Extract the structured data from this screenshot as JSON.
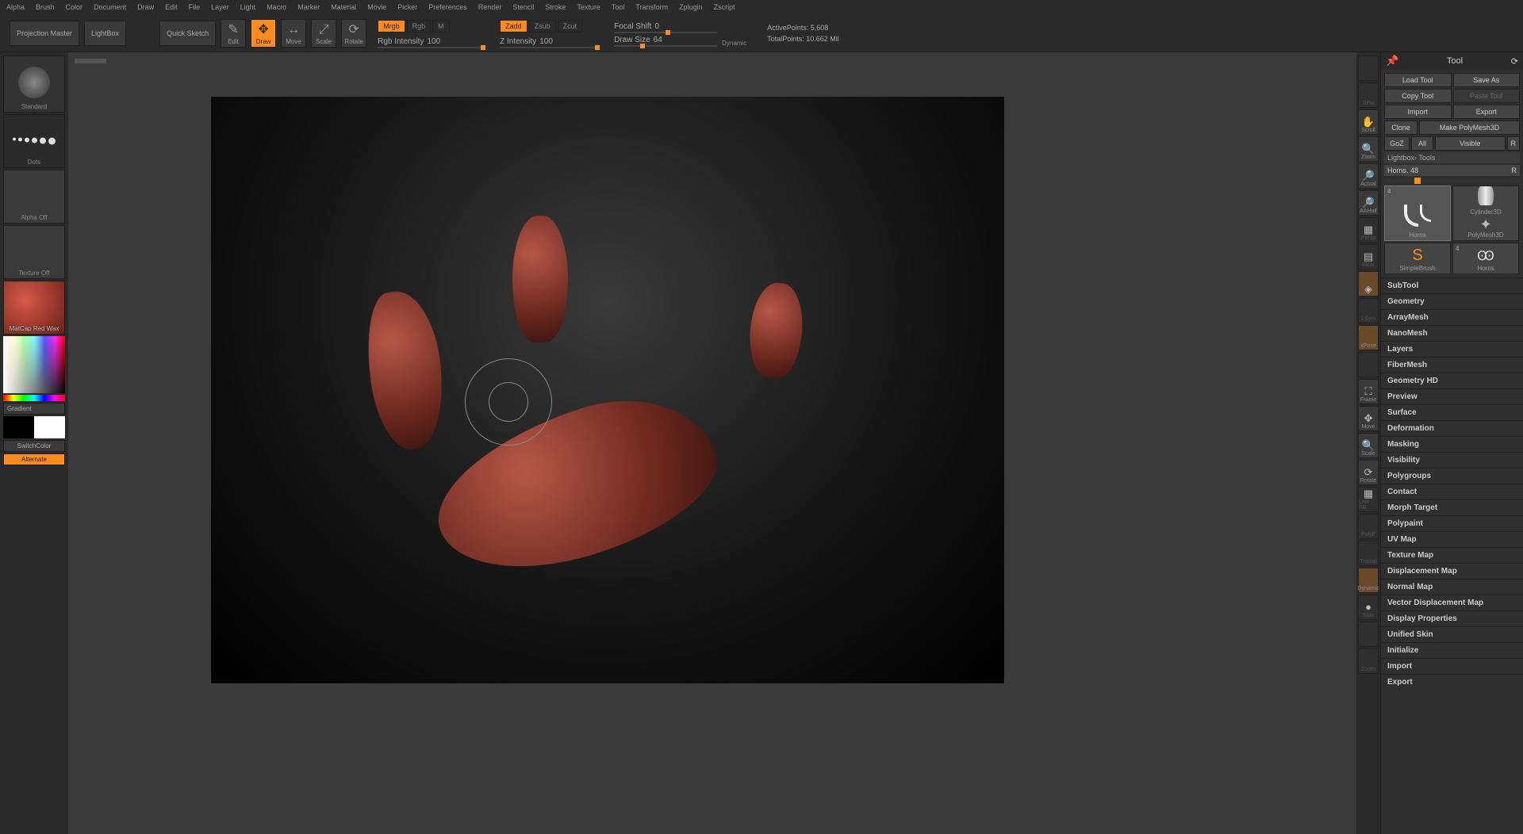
{
  "menubar": [
    "Alpha",
    "Brush",
    "Color",
    "Document",
    "Draw",
    "Edit",
    "File",
    "Layer",
    "Light",
    "Macro",
    "Marker",
    "Material",
    "Movie",
    "Picker",
    "Preferences",
    "Render",
    "Stencil",
    "Stroke",
    "Texture",
    "Tool",
    "Transform",
    "Zplugin",
    "Zscript"
  ],
  "toolbar": {
    "projection_master": "Projection Master",
    "lightbox": "LightBox",
    "quicksketch": "Quick Sketch",
    "edit": "Edit",
    "draw": "Draw",
    "move": "Move",
    "scale": "Scale",
    "rotate": "Rotate",
    "mrgb": "Mrgb",
    "rgb": "Rgb",
    "m": "M",
    "zadd": "Zadd",
    "zsub": "Zsub",
    "zcut": "Zcut",
    "rgb_intensity_label": "Rgb Intensity",
    "rgb_intensity_val": "100",
    "z_intensity_label": "Z Intensity",
    "z_intensity_val": "100",
    "focal_shift_label": "Focal Shift",
    "focal_shift_val": "0",
    "draw_size_label": "Draw Size",
    "draw_size_val": "64",
    "dynamic": "Dynamic",
    "active_points_label": "ActivePoints:",
    "active_points_val": "5,608",
    "total_points_label": "TotalPoints:",
    "total_points_val": "10.662 Mil"
  },
  "left": {
    "standard": "Standard",
    "dots": "Dots",
    "alpha_off": "Alpha Off",
    "texture_off": "Texture Off",
    "matcap": "MatCap Red Wax",
    "gradient": "Gradient",
    "switchcolor": "SwitchColor",
    "alternate": "Alternate"
  },
  "right_icons": [
    "",
    "SPix",
    "Scroll",
    "Zoom",
    "Actual",
    "AAHalf",
    "Persp",
    "Floor",
    "",
    "LSym",
    "xPose",
    "",
    "Frame",
    "Move",
    "Scale",
    "Rotate",
    "Line Fill",
    "PolyF",
    "Transp",
    "Dynamic",
    "Solo",
    "",
    "Zoom"
  ],
  "tool_panel": {
    "title": "Tool",
    "load_tool": "Load Tool",
    "save_as": "Save As",
    "copy_tool": "Copy Tool",
    "paste_tool": "Paste Tool",
    "import": "Import",
    "export": "Export",
    "clone": "Clone",
    "make_pm3d": "Make PolyMesh3D",
    "goz": "GoZ",
    "all": "All",
    "visible": "Visible",
    "r": "R",
    "lightbox_tools": "Lightbox› Tools",
    "tool_name": "Horns. 48",
    "thumbs": [
      {
        "label": "Horns",
        "type": "horns"
      },
      {
        "label": "Cylinder3D",
        "type": "cyl"
      },
      {
        "label": "",
        "type": "blank"
      },
      {
        "label": "PolyMesh3D",
        "type": "star"
      },
      {
        "label": "SimpleBrush",
        "type": "sbrush"
      },
      {
        "label": "Horns",
        "type": "horns2"
      }
    ],
    "accordion": [
      "SubTool",
      "Geometry",
      "ArrayMesh",
      "NanoMesh",
      "Layers",
      "FiberMesh",
      "Geometry HD",
      "Preview",
      "Surface",
      "Deformation",
      "Masking",
      "Visibility",
      "Polygroups",
      "Contact",
      "Morph Target",
      "Polypaint",
      "UV Map",
      "Texture Map",
      "Displacement Map",
      "Normal Map",
      "Vector Displacement Map",
      "Display Properties",
      "Unified Skin",
      "Initialize",
      "Import",
      "Export"
    ]
  }
}
